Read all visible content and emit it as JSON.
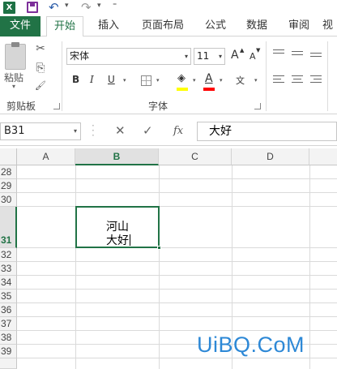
{
  "qat": {
    "app_logo": "X",
    "save_icon": "save-icon",
    "undo_icon": "undo-icon",
    "redo_icon": "redo-icon",
    "undo_glyph": "↶",
    "redo_glyph": "↷",
    "dropdown_glyph": "▾",
    "customize_glyph": "⁼"
  },
  "tabs": {
    "file": "文件",
    "items": [
      "开始",
      "插入",
      "页面布局",
      "公式",
      "数据",
      "审阅",
      "视"
    ],
    "active": "开始"
  },
  "ribbon": {
    "clipboard": {
      "paste_label": "粘贴",
      "group_label": "剪贴板",
      "cut_glyph": "✂",
      "copy_glyph": "⎘",
      "format_painter_glyph": "🖌"
    },
    "font": {
      "font_name": "宋体",
      "font_size": "11",
      "grow_label": "A",
      "shrink_label": "A",
      "bold_label": "B",
      "italic_label": "I",
      "underline_label": "U",
      "font_color_label": "A",
      "phonetic_label": "文",
      "group_label": "字体",
      "fill_color": "#ffff00",
      "font_color": "#ff0000"
    }
  },
  "formula_bar": {
    "name_box": "B31",
    "cancel_glyph": "✕",
    "enter_glyph": "✓",
    "fx_label": "fx",
    "content": "大好"
  },
  "grid": {
    "columns": [
      "A",
      "B",
      "C",
      "D"
    ],
    "selected_column": "B",
    "rows": [
      "28",
      "29",
      "30",
      "31",
      "32",
      "33",
      "34",
      "35",
      "36",
      "37",
      "38",
      "39"
    ],
    "selected_row": "31",
    "active_cell": {
      "ref": "B31",
      "lines": [
        "河山",
        "大好"
      ]
    }
  },
  "watermark": "UiBQ.CoM",
  "colors": {
    "accent": "#217346",
    "watermark": "#2d88d6"
  }
}
